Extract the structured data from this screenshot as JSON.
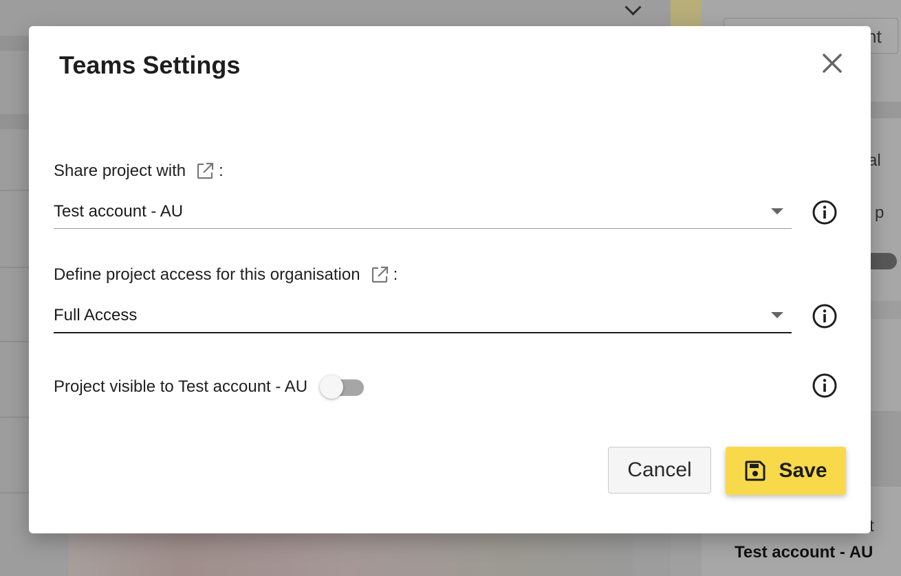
{
  "background": {
    "right_button_text": "nt",
    "right_text1": "al",
    "right_text2": "is p",
    "right_text3": "nisat",
    "right_bold": "Test account - AU"
  },
  "dialog": {
    "title": "Teams Settings",
    "close_icon": "close-icon",
    "share": {
      "label": "Share project with",
      "colon": ":",
      "selected": "Test account - AU"
    },
    "access": {
      "label": "Define project access for this organisation",
      "colon": ":",
      "selected": "Full Access"
    },
    "visibility": {
      "label": "Project visible to Test account - AU",
      "enabled": false
    },
    "buttons": {
      "cancel": "Cancel",
      "save": "Save"
    }
  },
  "colors": {
    "accent": "#f8d94a",
    "text": "#212121"
  }
}
